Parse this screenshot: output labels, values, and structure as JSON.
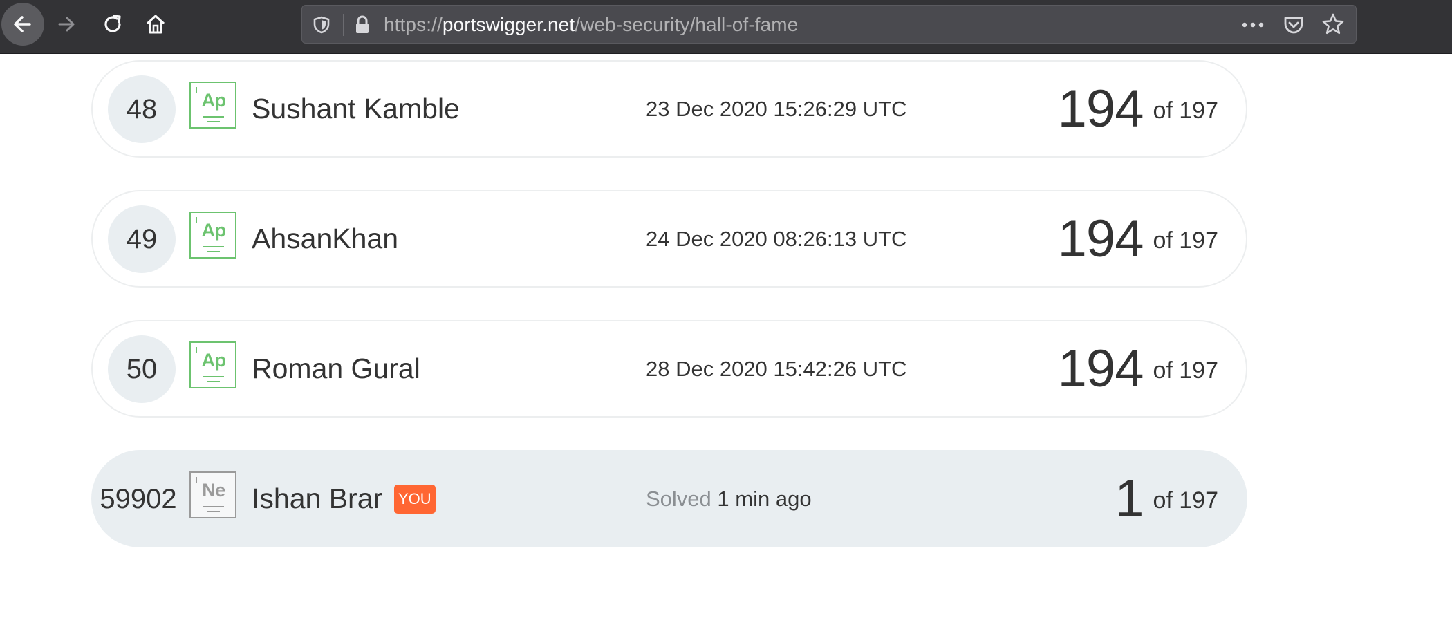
{
  "browser": {
    "url": {
      "prefix": "https://",
      "host": "portswigger.net",
      "path": "/web-security/hall-of-fame"
    }
  },
  "leaderboard": {
    "rows": [
      {
        "rank": "48",
        "element": "Ap",
        "name": "Sushant Kamble",
        "date": "23 Dec 2020 15:26:29 UTC",
        "score": "194",
        "total": "of 197"
      },
      {
        "rank": "49",
        "element": "Ap",
        "name": "AhsanKhan",
        "date": "24 Dec 2020 08:26:13 UTC",
        "score": "194",
        "total": "of 197"
      },
      {
        "rank": "50",
        "element": "Ap",
        "name": "Roman Gural",
        "date": "28 Dec 2020 15:42:26 UTC",
        "score": "194",
        "total": "of 197"
      }
    ],
    "self": {
      "rank": "59902",
      "element": "Ne",
      "name": "Ishan Brar",
      "badge": "YOU",
      "solved_label": "Solved",
      "solved_when": "1 min ago",
      "score": "1",
      "total": "of 197"
    }
  },
  "colors": {
    "badge_green": "#6cc36f",
    "badge_grey": "#9a9a9a",
    "you_badge": "#ff6633",
    "self_row_bg": "#e9eef1"
  }
}
